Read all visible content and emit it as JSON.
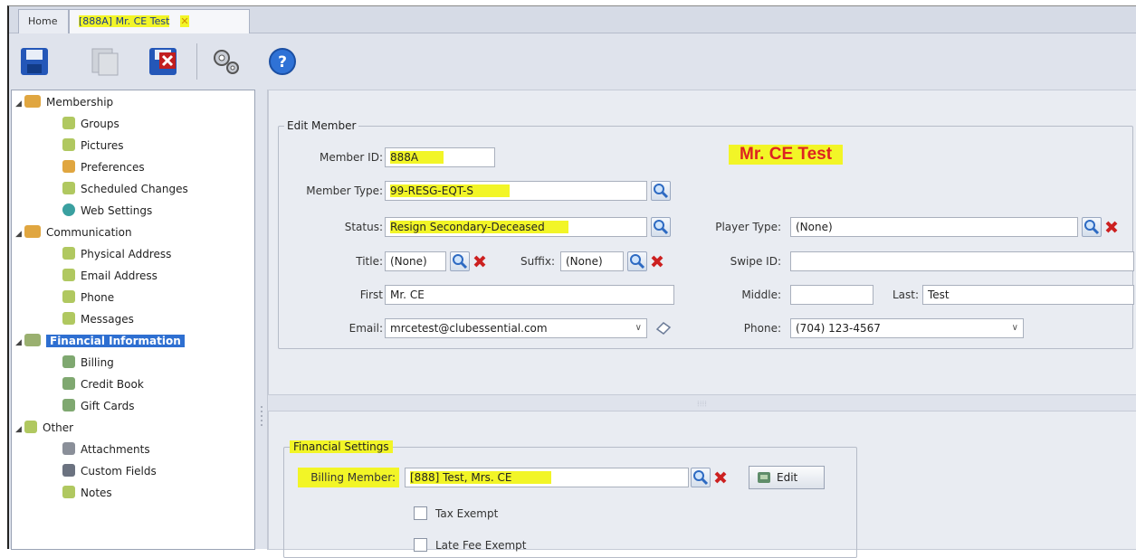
{
  "tabs": {
    "home": "Home",
    "active": "[888A] Mr. CE Test",
    "close": "✕"
  },
  "toolbar": {
    "save": "save-icon",
    "copy": "copy-icon",
    "delete": "delete-icon",
    "tools": "tools-icon",
    "help": "help-icon"
  },
  "sidebar": {
    "membership": "Membership",
    "groups": "Groups",
    "pictures": "Pictures",
    "preferences": "Preferences",
    "scheduled_changes": "Scheduled Changes",
    "web_settings": "Web Settings",
    "communication": "Communication",
    "physical_address": "Physical Address",
    "email_address": "Email Address",
    "phone": "Phone",
    "messages": "Messages",
    "financial_information": "Financial Information",
    "billing": "Billing",
    "credit_book": "Credit Book",
    "gift_cards": "Gift Cards",
    "other": "Other",
    "attachments": "Attachments",
    "custom_fields": "Custom Fields",
    "notes": "Notes"
  },
  "edit_member": {
    "legend": "Edit Member",
    "member_id_label": "Member ID:",
    "member_id": "888A",
    "display_name": "Mr. CE Test",
    "member_type_label": "Member Type:",
    "member_type": "99-RESG-EQT-S",
    "status_label": "Status:",
    "status": "Resign Secondary-Deceased",
    "player_type_label": "Player Type:",
    "player_type": "(None)",
    "title_label": "Title:",
    "title": "(None)",
    "suffix_label": "Suffix:",
    "suffix": "(None)",
    "swipe_id_label": "Swipe ID:",
    "swipe_id": "",
    "first_label": "First",
    "first": "Mr. CE",
    "middle_label": "Middle:",
    "middle": "",
    "last_label": "Last:",
    "last": "Test",
    "email_label": "Email:",
    "email": "mrcetest@clubessential.com",
    "phone_label": "Phone:",
    "phone": "(704) 123-4567",
    "dropdown_arrow": "∨"
  },
  "financial_settings": {
    "legend": "Financial Settings",
    "billing_member_label": "Billing Member:",
    "billing_member": "[888] Test, Mrs. CE",
    "edit_label": "Edit",
    "tax_exempt": "Tax Exempt",
    "late_fee_exempt": "Late Fee Exempt"
  },
  "splitter_grip": "⦙⦙⦙⦙"
}
